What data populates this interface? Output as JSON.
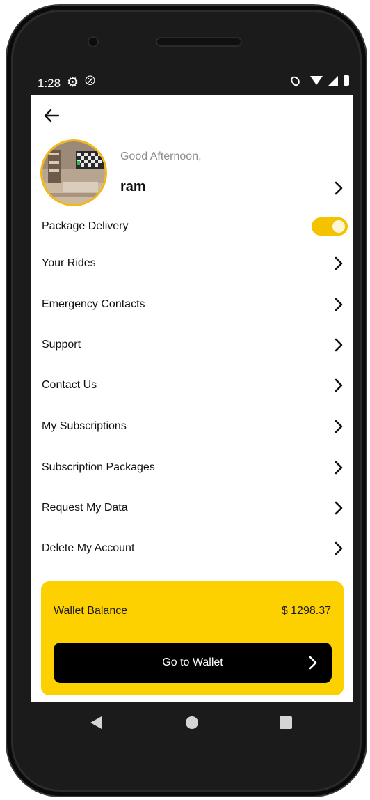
{
  "status_bar": {
    "time": "1:28"
  },
  "header": {
    "greeting": "Good Afternoon,",
    "username": "ram"
  },
  "menu": {
    "items": [
      {
        "label": "Package Delivery",
        "type": "toggle",
        "on": true
      },
      {
        "label": "Your Rides",
        "type": "link"
      },
      {
        "label": "Emergency Contacts",
        "type": "link"
      },
      {
        "label": "Support",
        "type": "link"
      },
      {
        "label": "Contact Us",
        "type": "link"
      },
      {
        "label": "My Subscriptions",
        "type": "link"
      },
      {
        "label": "Subscription Packages",
        "type": "link"
      },
      {
        "label": "Request My Data",
        "type": "link"
      },
      {
        "label": "Delete My Account",
        "type": "link"
      }
    ]
  },
  "wallet": {
    "label": "Wallet Balance",
    "amount": "$ 1298.37",
    "button_label": "Go to Wallet"
  },
  "colors": {
    "accent": "#fdd000",
    "toggle": "#f5c200",
    "avatar_ring": "#f3b813",
    "button_bg": "#000000"
  },
  "icons": {
    "back": "arrow-left-icon",
    "chevron": "chevron-right-icon",
    "settings": "gear-icon",
    "dnd": "do-not-disturb-icon",
    "location": "location-icon",
    "wifi": "wifi-icon",
    "signal": "signal-icon",
    "battery": "battery-icon"
  }
}
